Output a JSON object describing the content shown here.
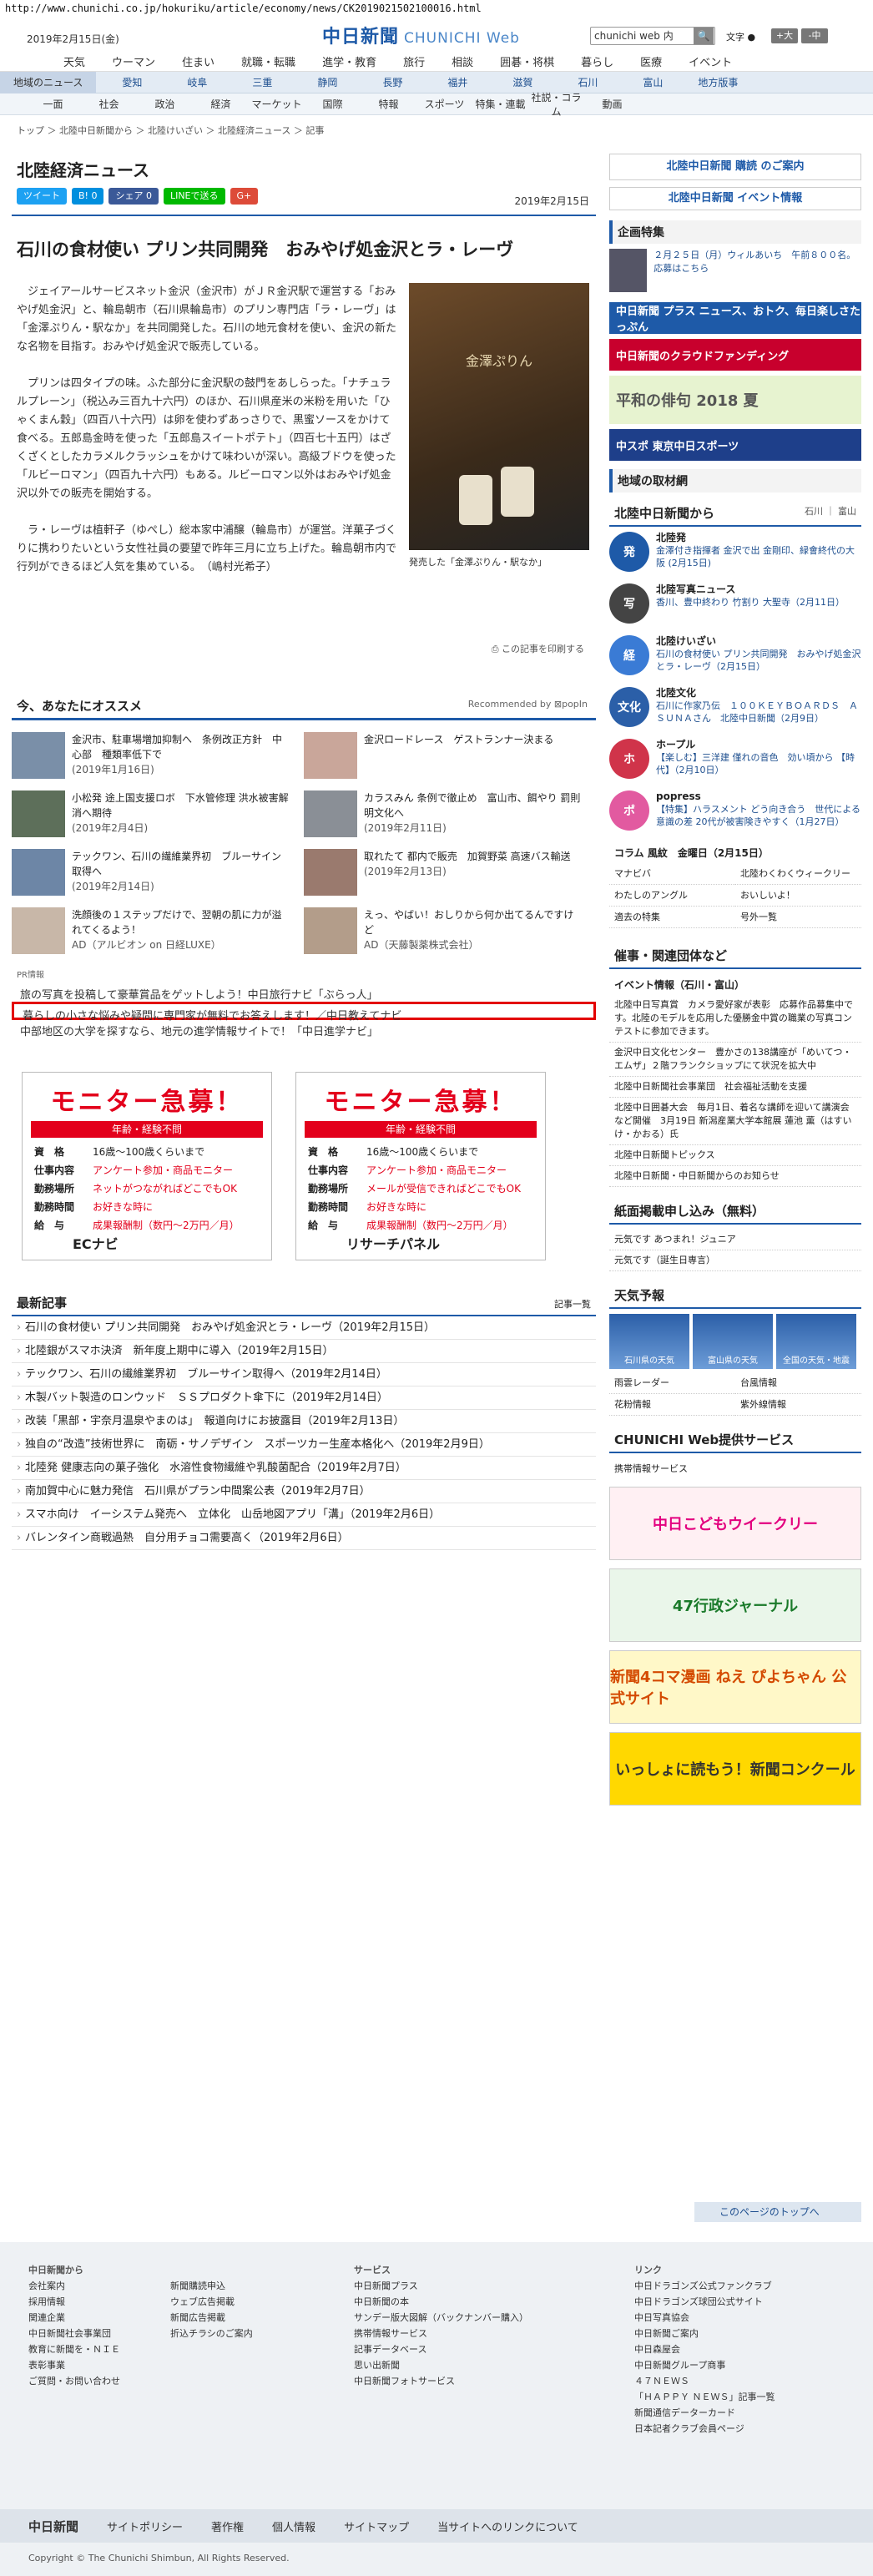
{
  "url": "http://www.chunichi.co.jp/hokuriku/article/economy/news/CK2019021502100016.html",
  "header": {
    "date": "2019年2月15日(金)",
    "logo": "中日新聞",
    "logo_sub": "CHUNICHI Web",
    "search_value": "chunichi web 内",
    "search_btn": "🔍",
    "font_label": "文字",
    "font_dot": "●",
    "font_big": "+大",
    "font_mid": "-中"
  },
  "gnav": [
    "天気",
    "ウーマン",
    "住まい",
    "就職・転職",
    "進学・教育",
    "旅行",
    "相談",
    "囲碁・将棋",
    "暮らし",
    "医療",
    "イベント"
  ],
  "rnav": {
    "head": "地域のニュース",
    "items": [
      "愛知",
      "岐阜",
      "三重",
      "静岡",
      "長野",
      "福井",
      "滋賀",
      "石川",
      "富山",
      "地方版事"
    ]
  },
  "cnav": [
    "一面",
    "社会",
    "政治",
    "経済",
    "マーケット",
    "国際",
    "特報",
    "スポーツ",
    "特集・連載",
    "社説・コラム",
    "動画"
  ],
  "crumb": "トップ ＞ 北陸中日新聞から ＞ 北陸けいざい ＞ 北陸経済ニュース ＞ 記事",
  "section_title": "北陸経済ニュース",
  "share": {
    "tweet": "ツイート",
    "hatena": "B! 0",
    "fb": "シェア 0",
    "line": "LINEで送る",
    "g": "G+"
  },
  "pubdate": "2019年2月15日",
  "headline": "石川の食材使い プリン共同開発　おみやげ処金沢とラ・レーヴ",
  "paras": [
    "ジェイアールサービスネット金沢（金沢市）がＪＲ金沢駅で運営する「おみやげ処金沢」と、輪島朝市（石川県輪島市）のプリン専門店「ラ・レーヴ」は「金澤ぷりん・駅なか」を共同開発した。石川の地元食材を使い、金沢の新たな名物を目指す。おみやげ処金沢で販売している。",
    "プリンは四タイプの味。ふた部分に金沢駅の鼓門をあしらった。「ナチュラルプレーン」（税込み三百九十六円）のほか、石川県産米の米粉を用いた「ひゃくまん穀」（四百八十六円）は卵を使わずあっさりで、黒蜜ソースをかけて食べる。五郎島金時を使った「五郎島スイートポテト」（四百七十五円）はざくざくとしたカラメルクラッシュをかけて味わいが深い。高級ブドウを使った「ルビーロマン」（四百九十六円）もある。ルビーロマン以外はおみやげ処金沢以外での販売を開始する。",
    "ラ・レーヴは植軒子（ゆぺし）総本家中浦醸（輪島市）が運営。洋菓子づくりに携わりたいという女性社員の要望で昨年三月に立ち上げた。輪島朝市内で行列ができるほど人気を集めている。　（嶋村光希子）"
  ],
  "photo_label": "金澤ぷりん",
  "caption": "発売した「金澤ぷりん・駅なか」",
  "print": "この記事を印刷する",
  "reco": {
    "title": "今、あなたにオススメ",
    "by": "Recommended by ⊠popIn",
    "items": [
      {
        "t": "金沢市、駐車場増加抑制へ　条例改正方針　中心部　種類率低下で",
        "d": "(2019年1月16日)"
      },
      {
        "t": "金沢ロードレース　ゲストランナー決まる",
        "d": ""
      },
      {
        "t": "小松発 途上国支援ロボ　下水管修理 洪水被害解消へ期待",
        "d": "(2019年2月4日)"
      },
      {
        "t": "カラスみん 条例で徹止め　富山市、餌やり 罰則明文化へ",
        "d": "(2019年2月11日)"
      },
      {
        "t": "テックワン、石川の繊維業界初　ブルーサイン取得へ",
        "d": "(2019年2月14日)"
      },
      {
        "t": "取れたて 都内で販売　加賀野菜 高速バス輸送",
        "d": "(2019年2月13日)"
      },
      {
        "t": "洗顔後の１ステップだけで、翌朝の肌に力が溢れてくるよう！",
        "d": "AD（アルビオン on 日経LUXE）"
      },
      {
        "t": "えっ、やばい！おしりから何か出てるんですけど",
        "d": "AD（天藤製薬株式会社）"
      }
    ]
  },
  "pr": "PR情報",
  "prlinks": [
    "旅の写真を投稿して豪華賞品をゲットしよう！中日旅行ナビ「ぶらっ人」",
    "暮らしの小さな悩みや疑問に専門家が無料でお答えします！／中日教えてナビ",
    "中部地区の大学を探すなら、地元の進学情報サイトで！「中日進学ナビ」"
  ],
  "ads": [
    {
      "big": "モニター急募！",
      "bar": "年齢・経験不問",
      "rows": [
        [
          "資　格",
          "16歳～100歳くらいまで"
        ],
        [
          "仕事内容",
          "アンケート参加・商品モニター"
        ],
        [
          "勤務場所",
          "ネットがつながればどこでもOK"
        ],
        [
          "勤務時間",
          "お好きな時に"
        ],
        [
          "給　与",
          "成果報酬制（数円～2万円／月）"
        ]
      ],
      "foot": "ECナビ"
    },
    {
      "big": "モニター急募！",
      "bar": "年齢・経験不問",
      "rows": [
        [
          "資　格",
          "16歳～100歳くらいまで"
        ],
        [
          "仕事内容",
          "アンケート参加・商品モニター"
        ],
        [
          "勤務場所",
          "メールが受信できればどこでもOK"
        ],
        [
          "勤務時間",
          "お好きな時に"
        ],
        [
          "給　与",
          "成果報酬制（数円～2万円／月）"
        ]
      ],
      "foot": "リサーチパネル"
    }
  ],
  "latest": {
    "title": "最新記事",
    "more": "記事一覧",
    "items": [
      "石川の食材使い プリン共同開発　おみやげ処金沢とラ・レーヴ（2019年2月15日）",
      "北陸銀がスマホ決済　新年度上期中に導入（2019年2月15日）",
      "テックワン、石川の繊維業界初　ブルーサイン取得へ（2019年2月14日）",
      "木製バット製造のロンウッド　ＳＳプロダクト傘下に（2019年2月14日）",
      "改装「黒部・宇奈月温泉やまのは」　報道向けにお披露目（2019年2月13日）",
      "独自の“改造”技術世界に　南砺・サノデザイン　スポーツカー生産本格化へ（2019年2月9日）",
      "北陸発 健康志向の菓子強化　水溶性食物繊維や乳酸菌配合（2019年2月7日）",
      "南加賀中心に魅力発信　石川県がプラン中間案公表（2019年2月7日）",
      "スマホ向け　イーシステム発売へ　立体化　山岳地図アプリ「溝」（2019年2月6日）",
      "バレンタイン商戦過熱　自分用チョコ需要高く（2019年2月6日）"
    ]
  },
  "side": {
    "subscribe": "北陸中日新聞 購読 のご案内",
    "event": "北陸中日新聞 イベント情報",
    "kikaku": "企画特集",
    "kikaku_txt": "２月２５日（月）ウィルあいち　午前８００名。応募はこちら",
    "banners": [
      "中日新聞 プラス ニュース、おトク、毎日楽しさたっぷん",
      "中日新聞のクラウドファンディング",
      "平和の俳句 2018 夏",
      "中スポ 東京中日スポーツ",
      "地域の取材網"
    ],
    "hk_title": "北陸中日新聞から",
    "hk_tabs": [
      "石川",
      "富山"
    ],
    "hk": [
      {
        "ic": "発",
        "c": "#1e5aa8",
        "b": "北陸発",
        "t": "金澤付き指揮者 金沢で出 金剛印、緑會終代の大阪 (2月15日)"
      },
      {
        "ic": "写",
        "c": "#444",
        "b": "北陸写真ニュース",
        "t": "香川、豊中終わり 竹割り 大聖寺（2月11日）"
      },
      {
        "ic": "経",
        "c": "#3a7bd5",
        "b": "北陸けいざい",
        "t": "石川の食材使い プリン共同開発　おみやげ処金沢とラ・レーヴ（2月15日）"
      },
      {
        "ic": "文化",
        "c": "#2b5fa8",
        "b": "北陸文化",
        "t": "石川に作家乃伝　１００ＫＥＹＢＯＡＲＤＳ　ＡＳＵＮＡさん　北陸中日新聞（2月9日）"
      },
      {
        "ic": "ホ",
        "c": "#d0344a",
        "b": "ホープル",
        "t": "【楽しむ】三洋建 僅れの音色　効い頃から 【時代】（2月10日）"
      },
      {
        "ic": "ポ",
        "c": "#e25aa0",
        "b": "popress",
        "t": "【特集】ハラスメント どう向き合う　世代による意識の差 20代が被害険きやすく（1月27日）"
      }
    ],
    "col": "コラム 風紋　金曜日（2月15日）",
    "grid": [
      "マナビバ",
      "北陸わくわくウィークリー",
      "わたしのアングル",
      "おいしいよ！",
      "適去の特集",
      "号外一覧"
    ],
    "org_title": "催事・関連団体など",
    "org_event": "イベント情報（石川・富山）",
    "orgs": [
      "北陸中日写真賞　カメラ愛好家が表彰　応募作品募集中です。北陸のモデルを応用した優勝金中賞の職業の写真コンテストに参加できます。",
      "金沢中日文化センター　豊かさの138講座が「めいてつ・エムザ」２階フランクショップにて状況を拡大中",
      "北陸中日新聞社会事業団　社会福祉活動を支援",
      "北陸中日囲碁大会　毎月1日、着名な講師を迎いて講演会など開催　3月19日 新潟産業大学本館展 蓮池 薫（はすいけ・かおる）氏",
      "北陸中日新聞トピックス",
      "北陸中日新聞・中日新聞からのお知らせ"
    ],
    "kami": "紙面掲載申し込み（無料）",
    "kami_items": [
      "元気です あつまれ！ジュニア",
      "元気です（誕生日専言）"
    ],
    "weather": "天気予報",
    "wx": [
      "石川県の天気",
      "富山県の天気",
      "全国の天気・地震"
    ],
    "wx_links": [
      "雨雲レーダー",
      "台風情報",
      "花粉情報",
      "紫外線情報"
    ],
    "svc": "CHUNICHI Web提供サービス",
    "svc_link": "携帯情報サービス",
    "big": [
      "中日こどもウイークリー",
      "47行政ジャーナル",
      "新聞4コマ漫画 ねえ ぴよちゃん 公式サイト",
      "いっしょに読もう！新聞コンクール"
    ]
  },
  "totop": "このページのトップへ",
  "footer": {
    "c1": {
      "h": "中日新聞から",
      "l": [
        "会社案内",
        "採用情報",
        "関連企業",
        "中日新聞社会事業団",
        "教育に新聞を・ＮＩＥ",
        "表彰事業",
        "ご質問・お問い合わせ"
      ]
    },
    "c1b": [
      "新聞購読申込",
      "ウェブ広告掲載",
      "新聞広告掲載",
      "折込チラシのご案内"
    ],
    "c2": {
      "h": "サービス",
      "l": [
        "中日新聞プラス",
        "中日新聞の本",
        "サンデー版大図解（バックナンバー購入）",
        "携帯情報サービス",
        "記事データベース",
        "思い出新聞",
        "中日新聞フォトサービス"
      ]
    },
    "c3": {
      "h": "リンク",
      "l": [
        "中日ドラゴンズ公式ファンクラブ",
        "中日ドラゴンズ球団公式サイト",
        "中日写真協会",
        "中日新聞ご案内",
        "中日森屋会",
        "中日新聞グループ商事",
        "４７ＮＥＷＳ",
        "「ＨＡＰＰＹ ＮＥＷＳ」記事一覧",
        "新聞通信データーカード",
        "日本記者クラブ会員ページ"
      ]
    },
    "bar": [
      "中日新聞",
      "サイトポリシー",
      "著作権",
      "個人情報",
      "サイトマップ",
      "当サイトへのリンクについて"
    ],
    "copy": "Copyright © The Chunichi Shimbun, All Rights Reserved."
  },
  "colors": {
    "accent": "#1e5aa8",
    "red": "#e3001b"
  }
}
